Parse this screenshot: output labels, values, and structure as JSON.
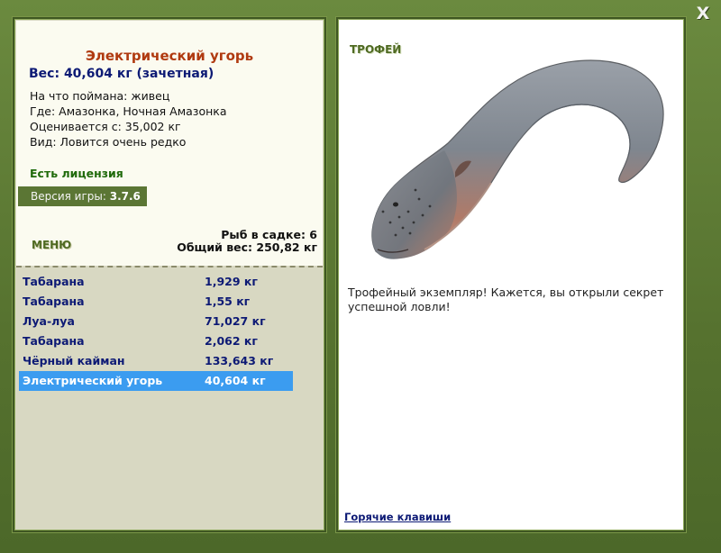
{
  "window": {
    "close_label": "X"
  },
  "fish": {
    "title": "Электрический угорь",
    "weight_line": "Вес: 40,604 кг (зачетная)",
    "caught_on": "На что поймана: живец",
    "location": "Где: Амазонка, Ночная Амазонка",
    "valued_from": "Оценивается с: 35,002 кг",
    "rarity": "Вид: Ловится очень редко"
  },
  "license": "Есть лицензия",
  "version": {
    "label": "Версия игры:",
    "value": "3.7.6"
  },
  "menu_label": "МЕНЮ",
  "stats": {
    "fish_in_keepnet": "Рыб в садке: 6",
    "total_weight": "Общий вес: 250,82 кг"
  },
  "catch_list": [
    {
      "name": "Табарана",
      "weight": "1,929 кг"
    },
    {
      "name": "Табарана",
      "weight": "1,55 кг"
    },
    {
      "name": "Луа-луа",
      "weight": "71,027 кг"
    },
    {
      "name": "Табарана",
      "weight": "2,062 кг"
    },
    {
      "name": "Чёрный кайман",
      "weight": "133,643 кг"
    },
    {
      "name": "Электрический угорь",
      "weight": "40,604 кг"
    }
  ],
  "selected_index": 5,
  "trophy": {
    "label": "ТРОФЕЙ",
    "text": "Трофейный экземпляр! Кажется, вы открыли секрет успешной ловли!"
  },
  "hotkeys_label": "Горячие клавиши",
  "colors": {
    "frame_green": "#5d7a35",
    "title_orange": "#b03a10",
    "text_navy": "#0d1a75",
    "selection_blue": "#3b9cf0",
    "license_green": "#1f6a0a"
  }
}
